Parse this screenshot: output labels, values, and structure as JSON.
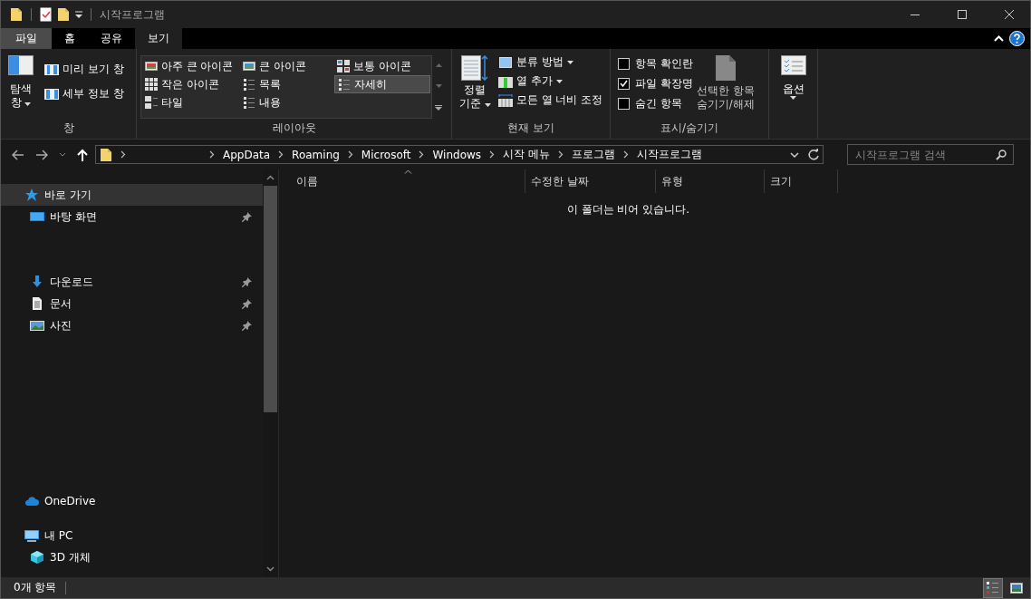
{
  "window": {
    "title": "시작프로그램"
  },
  "ribbon_tabs": [
    {
      "label": "파일",
      "selected": false,
      "kind": "file"
    },
    {
      "label": "홈",
      "selected": false,
      "kind": "tab"
    },
    {
      "label": "공유",
      "selected": false,
      "kind": "tab"
    },
    {
      "label": "보기",
      "selected": true,
      "kind": "tab"
    }
  ],
  "panes_group": {
    "title": "창",
    "nav_pane": [
      "탐색",
      "창"
    ],
    "buttons": [
      "미리 보기 창",
      "세부 정보 창"
    ]
  },
  "layout_group": {
    "title": "레이아웃",
    "items": [
      {
        "label": "아주 큰 아이콘",
        "selected": false,
        "kind": "xl"
      },
      {
        "label": "큰 아이콘",
        "selected": false,
        "kind": "large"
      },
      {
        "label": "보통 아이콘",
        "selected": false,
        "kind": "medium"
      },
      {
        "label": "작은 아이콘",
        "selected": false,
        "kind": "small"
      },
      {
        "label": "목록",
        "selected": false,
        "kind": "list"
      },
      {
        "label": "자세히",
        "selected": true,
        "kind": "details"
      },
      {
        "label": "타일",
        "selected": false,
        "kind": "tiles"
      },
      {
        "label": "내용",
        "selected": false,
        "kind": "content"
      }
    ]
  },
  "current_view_group": {
    "title": "현재 보기",
    "sort": [
      "정렬",
      "기준"
    ],
    "buttons": [
      {
        "label": "분류 방법",
        "dropdown": true,
        "kind": "group"
      },
      {
        "label": "열 추가",
        "dropdown": true,
        "kind": "addcol"
      },
      {
        "label": "모든 열 너비 조정",
        "dropdown": false,
        "kind": "fit"
      }
    ]
  },
  "show_hide_group": {
    "title": "표시/숨기기",
    "checkboxes": [
      {
        "label": "항목 확인란",
        "checked": false
      },
      {
        "label": "파일 확장명",
        "checked": true
      },
      {
        "label": "숨긴 항목",
        "checked": false
      }
    ],
    "hide_selected": [
      "선택한 항목",
      "숨기기/해제"
    ]
  },
  "options_group": {
    "label": "옵션"
  },
  "address": {
    "segments": [
      "AppData",
      "Roaming",
      "Microsoft",
      "Windows",
      "시작 메뉴",
      "프로그램",
      "시작프로그램"
    ]
  },
  "search": {
    "placeholder": "시작프로그램 검색"
  },
  "columns": [
    "이름",
    "수정한 날짜",
    "유형",
    "크기"
  ],
  "empty_message": "이 폴더는 비어 있습니다.",
  "sidebar": [
    {
      "label": "바로 가기",
      "kind": "star",
      "selected": true,
      "children": [
        {
          "label": "바탕 화면",
          "kind": "desktop",
          "pinned": true,
          "selected": false
        },
        {
          "label": "다운로드",
          "kind": "download",
          "pinned": true,
          "selected": false
        },
        {
          "label": "문서",
          "kind": "document",
          "pinned": true,
          "selected": false
        },
        {
          "label": "사진",
          "kind": "picture",
          "pinned": true,
          "selected": false
        }
      ]
    },
    {
      "label": "OneDrive",
      "kind": "cloud",
      "selected": false
    },
    {
      "label": "내 PC",
      "kind": "pc",
      "selected": false,
      "children": [
        {
          "label": "3D 개체",
          "kind": "cube",
          "pinned": false,
          "selected": false
        }
      ]
    }
  ],
  "status_bar": {
    "count": "0개 항목",
    "views": [
      {
        "kind": "details",
        "selected": true
      },
      {
        "kind": "large",
        "selected": false
      }
    ]
  }
}
